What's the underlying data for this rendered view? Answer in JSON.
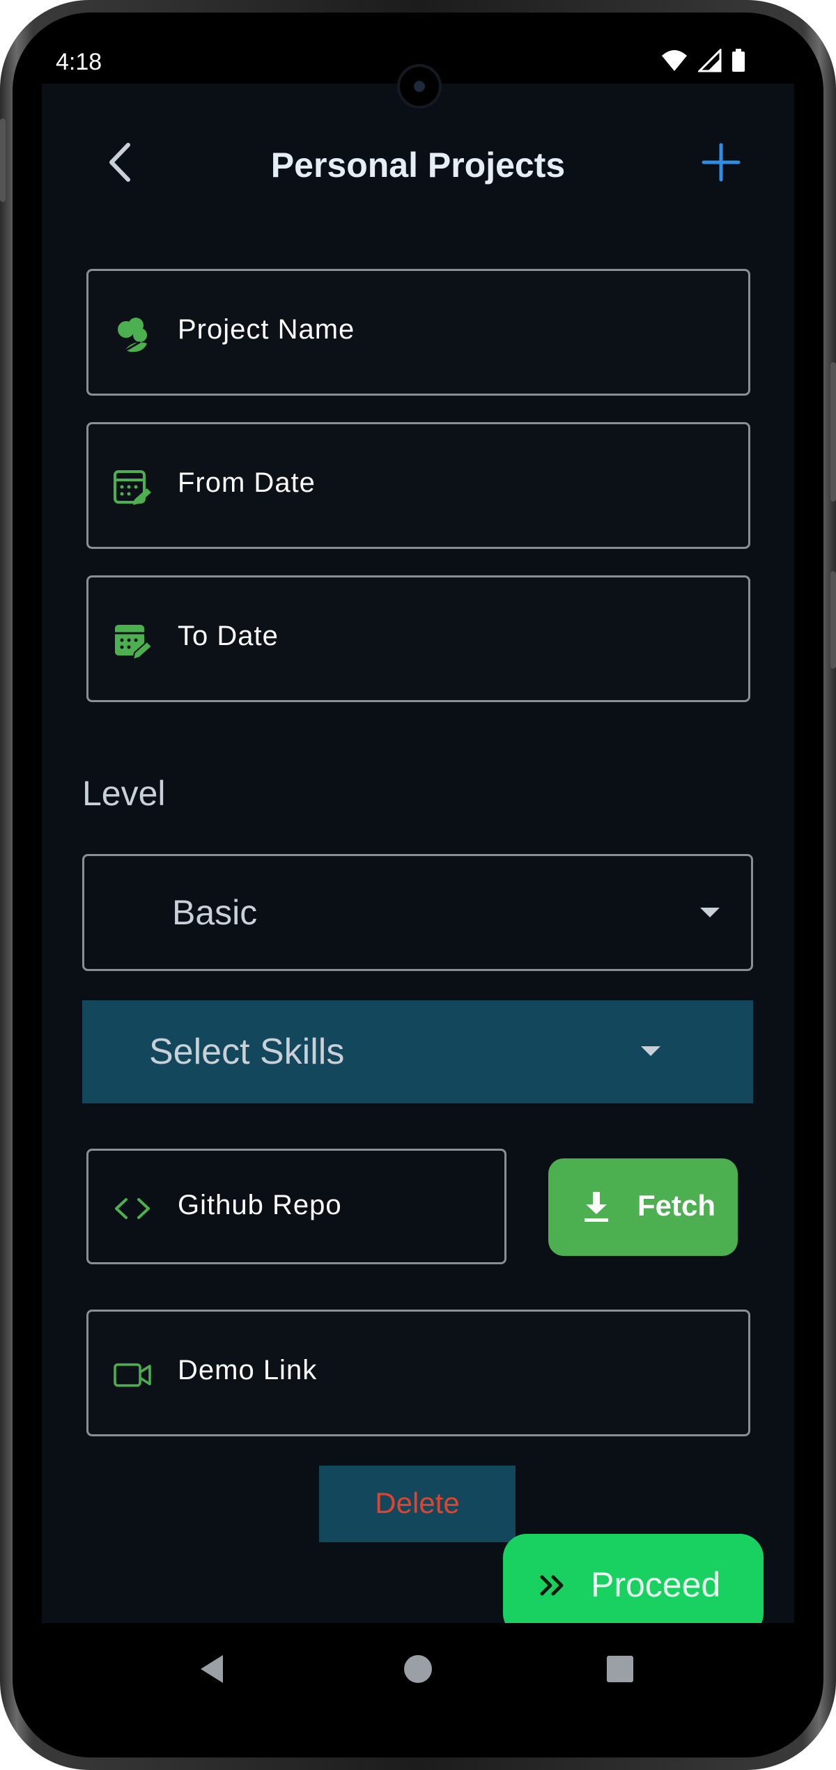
{
  "status_bar": {
    "time": "4:18",
    "icons": [
      "wifi-icon",
      "cellular-icon",
      "battery-icon"
    ]
  },
  "header": {
    "title": "Personal Projects",
    "back_icon": "chevron-left-icon",
    "add_icon": "plus-icon"
  },
  "form": {
    "project_name": {
      "placeholder": "Project Name",
      "icon": "leaf-icon"
    },
    "from_date": {
      "placeholder": "From Date",
      "icon": "calendar-edit-icon"
    },
    "to_date": {
      "placeholder": "To Date",
      "icon": "calendar-edit-filled-icon"
    },
    "level": {
      "label": "Level",
      "selected": "Basic"
    },
    "skills": {
      "placeholder": "Select Skills"
    },
    "github_repo": {
      "placeholder": "Github Repo",
      "icon": "code-icon"
    },
    "fetch_button": {
      "label": "Fetch",
      "icon": "download-icon"
    },
    "demo_link": {
      "placeholder": "Demo Link",
      "icon": "video-icon"
    }
  },
  "actions": {
    "delete_label": "Delete",
    "proceed_label": "Proceed",
    "proceed_icon": "double-chevron-right-icon"
  },
  "nav_bar": {
    "items": [
      "back-triangle-icon",
      "home-circle-icon",
      "recents-square-icon"
    ]
  },
  "colors": {
    "background": "#0a0f15",
    "accent_green": "#4caf50",
    "proceed_green": "#18d160",
    "select_blue": "#13475c",
    "delete_red": "#e0442f",
    "add_blue": "#2f8de4"
  }
}
